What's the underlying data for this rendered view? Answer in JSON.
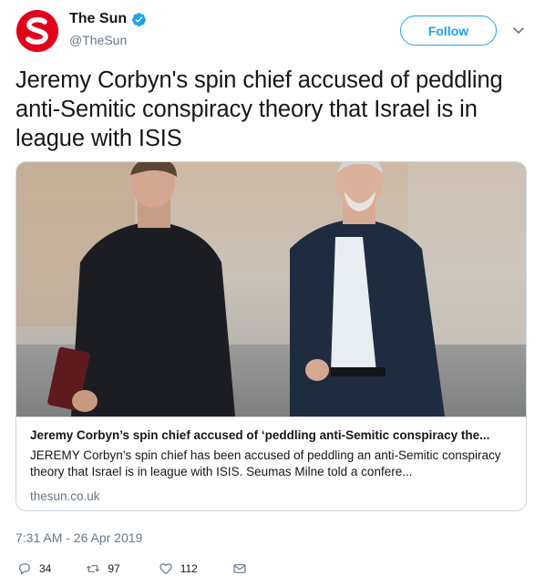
{
  "account": {
    "display_name": "The Sun",
    "handle": "@TheSun",
    "avatar_color": "#e2001a",
    "verified": true
  },
  "follow_label": "Follow",
  "tweet_text": "Jeremy Corbyn's spin chief accused of peddling anti-Semitic conspiracy theory that Israel is in league with ISIS",
  "card": {
    "title": "Jeremy Corbyn’s spin chief accused of ‘peddling anti-Semitic conspiracy the...",
    "description": "JEREMY Corbyn’s spin chief has been accused of peddling an anti-Semitic conspiracy theory that Israel is in league with ISIS. Seumas Milne told a confere...",
    "domain": "thesun.co.uk"
  },
  "timestamp": "7:31 AM - 26 Apr 2019",
  "actions": {
    "replies": "34",
    "retweets": "97",
    "likes": "112"
  },
  "colors": {
    "accent": "#1da1f2",
    "muted": "#657786",
    "border": "#ccd6dd"
  }
}
